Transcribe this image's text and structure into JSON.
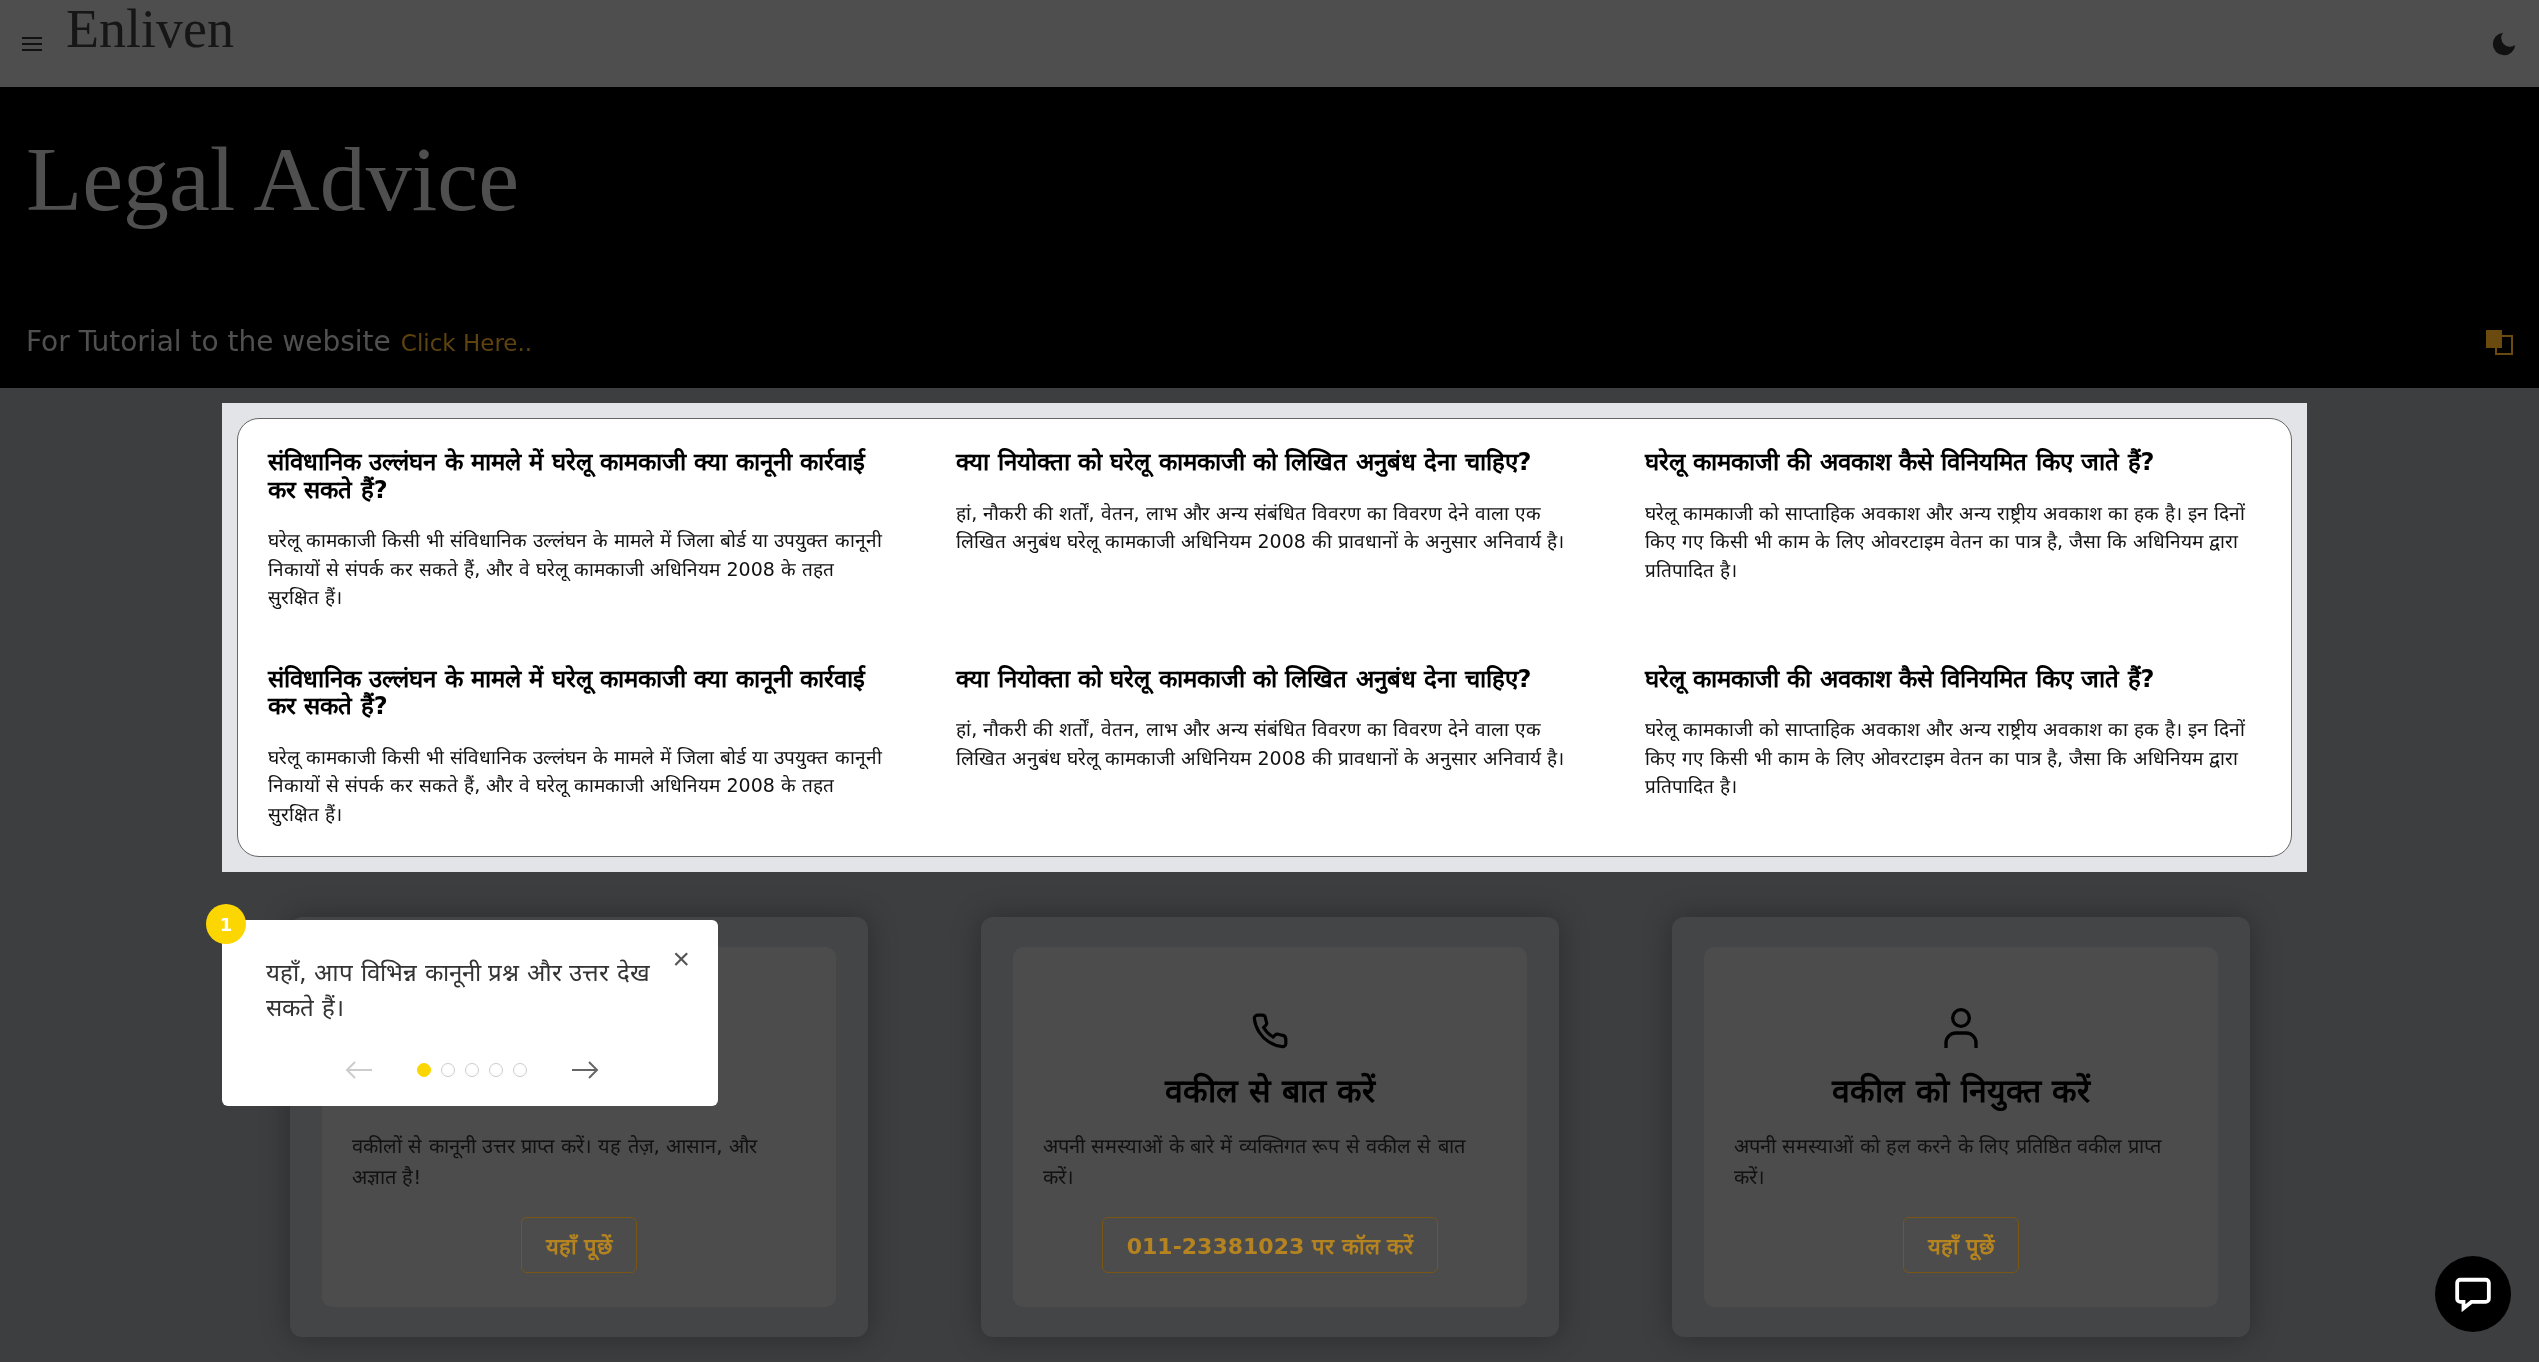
{
  "header": {
    "logo": "Enliven"
  },
  "hero": {
    "title": "Legal Advice",
    "tutorial_text": "For Tutorial to the website",
    "tutorial_link": "Click Here.."
  },
  "faq": [
    {
      "question": "संविधानिक उल्लंघन के मामले में घरेलू कामकाजी क्या कानूनी कार्रवाई कर सकते हैं?",
      "answer": "घरेलू कामकाजी किसी भी संविधानिक उल्लंघन के मामले में जिला बोर्ड या उपयुक्त कानूनी निकायों से संपर्क कर सकते हैं, और वे घरेलू कामकाजी अधिनियम 2008 के तहत सुरक्षित हैं।"
    },
    {
      "question": "क्या नियोक्ता को घरेलू कामकाजी को लिखित अनुबंध देना चाहिए?",
      "answer": "हां, नौकरी की शर्तों, वेतन, लाभ और अन्य संबंधित विवरण का विवरण देने वाला एक लिखित अनुबंध घरेलू कामकाजी अधिनियम 2008 की प्रावधानों के अनुसार अनिवार्य है।"
    },
    {
      "question": "घरेलू कामकाजी की अवकाश कैसे विनियमित किए जाते हैं?",
      "answer": "घरेलू कामकाजी को साप्ताहिक अवकाश और अन्य राष्ट्रीय अवकाश का हक है। इन दिनों किए गए किसी भी काम के लिए ओवरटाइम वेतन का पात्र है, जैसा कि अधिनियम द्वारा प्रतिपादित है।"
    },
    {
      "question": "संविधानिक उल्लंघन के मामले में घरेलू कामकाजी क्या कानूनी कार्रवाई कर सकते हैं?",
      "answer": "घरेलू कामकाजी किसी भी संविधानिक उल्लंघन के मामले में जिला बोर्ड या उपयुक्त कानूनी निकायों से संपर्क कर सकते हैं, और वे घरेलू कामकाजी अधिनियम 2008 के तहत सुरक्षित हैं।"
    },
    {
      "question": "क्या नियोक्ता को घरेलू कामकाजी को लिखित अनुबंध देना चाहिए?",
      "answer": "हां, नौकरी की शर्तों, वेतन, लाभ और अन्य संबंधित विवरण का विवरण देने वाला एक लिखित अनुबंध घरेलू कामकाजी अधिनियम 2008 की प्रावधानों के अनुसार अनिवार्य है।"
    },
    {
      "question": "घरेलू कामकाजी की अवकाश कैसे विनियमित किए जाते हैं?",
      "answer": "घरेलू कामकाजी को साप्ताहिक अवकाश और अन्य राष्ट्रीय अवकाश का हक है। इन दिनों किए गए किसी भी काम के लिए ओवरटाइम वेतन का पात्र है, जैसा कि अधिनियम द्वारा प्रतिपादित है।"
    }
  ],
  "services": [
    {
      "description": "वकीलों से कानूनी उत्तर प्राप्त करें। यह तेज़, आसान, और अज्ञात है!",
      "button": "यहाँ पूछें"
    },
    {
      "title": "वकील से बात करें",
      "description": "अपनी समस्याओं के बारे में व्यक्तिगत रूप से वकील से बात करें।",
      "button": "011-23381023 पर कॉल करें"
    },
    {
      "title": "वकील को नियुक्त करें",
      "description": "अपनी समस्याओं को हल करने के लिए प्रतिष्ठित वकील प्राप्त करें।",
      "button": "यहाँ पूछें"
    }
  ],
  "tour": {
    "step": "1",
    "text": "यहाँ, आप विभिन्न कानूनी प्रश्न और उत्तर देख सकते हैं।",
    "close": "×",
    "dots": [
      {
        "selected": true
      },
      {
        "selected": false
      },
      {
        "selected": false
      },
      {
        "selected": false
      },
      {
        "selected": false
      }
    ]
  }
}
